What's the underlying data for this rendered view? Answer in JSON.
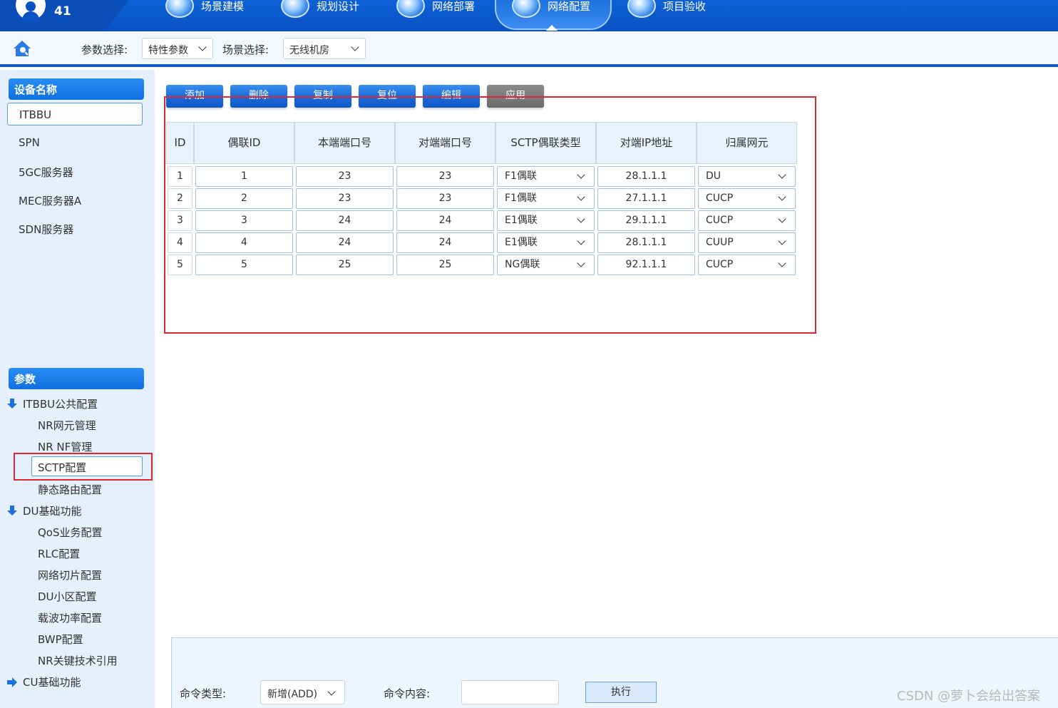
{
  "header": {
    "user_number": "41",
    "nav": [
      "场景建模",
      "规划设计",
      "网络部署",
      "网络配置",
      "项目验收"
    ],
    "active_nav": "网络配置"
  },
  "filters": {
    "param_label": "参数选择:",
    "param_value": "特性参数",
    "scene_label": "场景选择:",
    "scene_value": "无线机房"
  },
  "sidebar": {
    "device_header": "设备名称",
    "devices": [
      "ITBBU",
      "SPN",
      "5GC服务器",
      "MEC服务器A",
      "SDN服务器"
    ],
    "selected_device": "ITBBU",
    "param_header": "参数",
    "tree": {
      "group1": "ITBBU公共配置",
      "group1_items": [
        "NR网元管理",
        "NR NF管理",
        "SCTP配置",
        "静态路由配置"
      ],
      "group2": "DU基础功能",
      "group2_items": [
        "QoS业务配置",
        "RLC配置",
        "网络切片配置",
        "DU小区配置",
        "载波功率配置",
        "BWP配置",
        "NR关键技术引用"
      ],
      "group3": "CU基础功能"
    },
    "selected_item": "SCTP配置"
  },
  "toolbar": {
    "buttons": [
      "添加",
      "删除",
      "复制",
      "复位",
      "编辑",
      "应用"
    ]
  },
  "table": {
    "headers": [
      "ID",
      "偶联ID",
      "本端端口号",
      "对端端口号",
      "SCTP偶联类型",
      "对端IP地址",
      "归属网元"
    ],
    "rows": [
      {
        "id": "1",
        "assoc_id": "1",
        "local_port": "23",
        "peer_port": "23",
        "type": "F1偶联",
        "peer_ip": "28.1.1.1",
        "ne": "DU"
      },
      {
        "id": "2",
        "assoc_id": "2",
        "local_port": "23",
        "peer_port": "23",
        "type": "F1偶联",
        "peer_ip": "27.1.1.1",
        "ne": "CUCP"
      },
      {
        "id": "3",
        "assoc_id": "3",
        "local_port": "24",
        "peer_port": "24",
        "type": "E1偶联",
        "peer_ip": "29.1.1.1",
        "ne": "CUCP"
      },
      {
        "id": "4",
        "assoc_id": "4",
        "local_port": "24",
        "peer_port": "24",
        "type": "E1偶联",
        "peer_ip": "28.1.1.1",
        "ne": "CUUP"
      },
      {
        "id": "5",
        "assoc_id": "5",
        "local_port": "25",
        "peer_port": "25",
        "type": "NG偶联",
        "peer_ip": "92.1.1.1",
        "ne": "CUCP"
      }
    ]
  },
  "command": {
    "type_label": "命令类型:",
    "type_value": "新增(ADD)",
    "content_label": "命令内容:",
    "content_value": "",
    "execute_label": "执行"
  },
  "watermark": "CSDN @萝卜会给出答案",
  "colors": {
    "brand_blue": "#0a52c4",
    "button_blue": "#1766d4",
    "highlight_red": "#e0262f",
    "sidebar_bg": "#e6f0fc"
  }
}
